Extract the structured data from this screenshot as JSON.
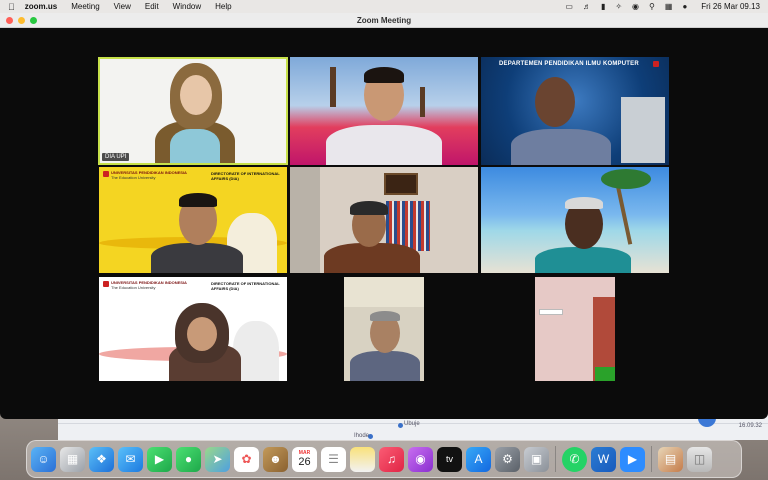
{
  "menubar": {
    "app_name": "zoom.us",
    "menus": [
      "Meeting",
      "View",
      "Edit",
      "Window",
      "Help"
    ],
    "clock": "Fri 26 Mar  09.13"
  },
  "window": {
    "title": "Zoom Meeting"
  },
  "participants": [
    {
      "name_tag": "DIA UPI"
    }
  ],
  "backgrounds": {
    "tile3_banner": "DEPARTEMEN PENDIDIKAN ILMU KOMPUTER",
    "university": "UNIVERSITAS PENDIDIKAN INDONESIA",
    "university_sub": "The Education University",
    "directorate": "DIRECTORATE OF INTERNATIONAL AFFAIRS (DIA)"
  },
  "bg_window": {
    "label1": "Ubuje",
    "label2": "Ihode",
    "right_text": "16.09.32"
  },
  "dock": {
    "calendar_month": "MAR",
    "calendar_day": "26",
    "tv_label": "tv"
  }
}
